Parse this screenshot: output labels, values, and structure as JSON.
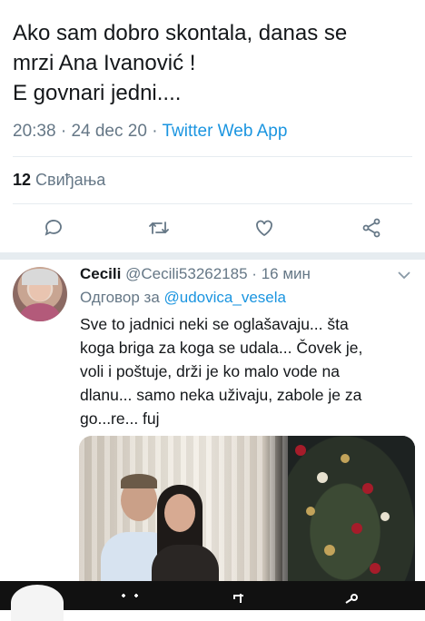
{
  "main_tweet": {
    "text": "Ako sam dobro skontala, danas se\nmrzi Ana Ivanović !\nE govnari jedni....",
    "time": "20:38",
    "date": "24 dec 20",
    "separator": "·",
    "source_app": "Twitter Web App",
    "likes_count": "12",
    "likes_label": "Свиђања"
  },
  "actions": [
    {
      "name": "reply-icon"
    },
    {
      "name": "retweet-icon"
    },
    {
      "name": "like-icon"
    },
    {
      "name": "share-icon"
    }
  ],
  "reply": {
    "display_name": "Cecili",
    "handle": "@Cecili53262185",
    "separator": "·",
    "time": "16 мин",
    "reply_to_label": "Одговор за",
    "reply_to_handle": "@udovica_vesela",
    "text": "Sve to jadnici neki se oglašavaju... šta\nkoga briga za koga se udala... Čovek je,\nvoli i poštuje, drži je ko malo vode na\ndlanu... samo neka uživaju, zabole je za\ngo...re... fuj"
  },
  "colors": {
    "accent": "#1b95e0",
    "secondary_text": "#657786",
    "divider": "#e6ecf0"
  }
}
